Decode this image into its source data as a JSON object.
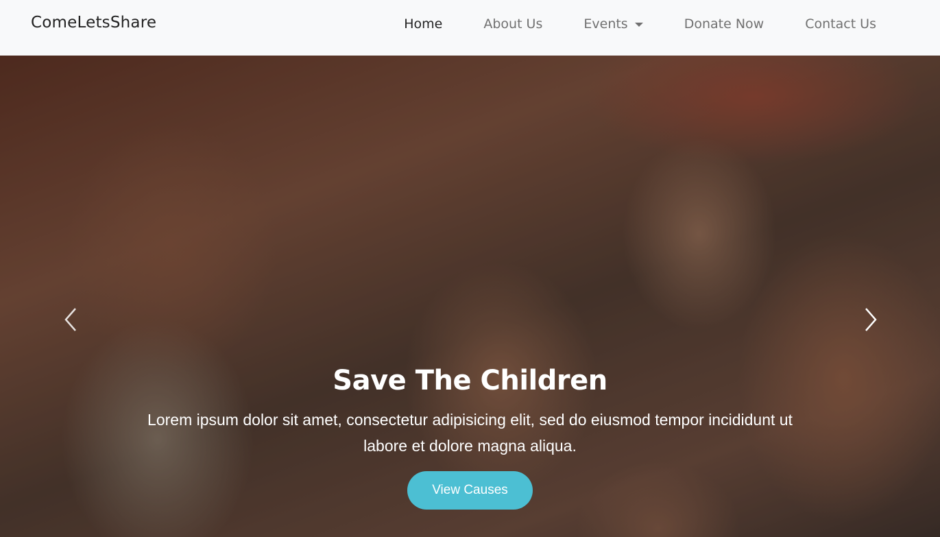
{
  "navbar": {
    "brand": "ComeLetsShare",
    "links": [
      {
        "label": "Home",
        "active": true
      },
      {
        "label": "About Us"
      },
      {
        "label": "Events",
        "dropdown": true
      },
      {
        "label": "Donate Now"
      },
      {
        "label": "Contact Us"
      }
    ]
  },
  "hero": {
    "title": "Save The Children",
    "text": "Lorem ipsum dolor sit amet, consectetur adipisicing elit, sed do eiusmod tempor incididunt ut labore et dolore magna aliqua.",
    "button_label": "View Causes",
    "prev_icon": "chevron-left-icon",
    "next_icon": "chevron-right-icon"
  },
  "colors": {
    "navbar_bg": "#f8f9fa",
    "accent": "#4cbfd3"
  }
}
